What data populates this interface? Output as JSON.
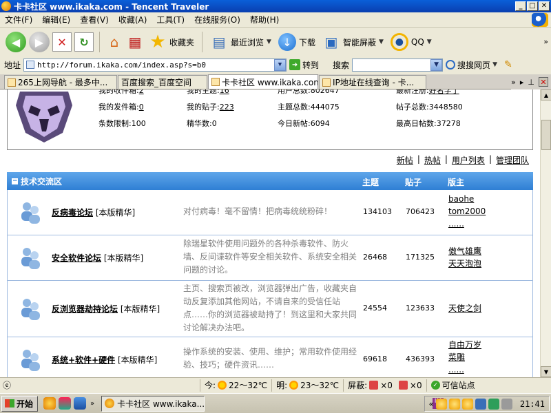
{
  "window": {
    "title": "卡卡社区 www.ikaka.com - Tencent Traveler",
    "btn_min": "_",
    "btn_max": "□",
    "btn_close": "✕"
  },
  "menu": [
    "文件(F)",
    "编辑(E)",
    "查看(V)",
    "收藏(A)",
    "工具(T)",
    "在线服务(O)",
    "帮助(H)"
  ],
  "toolbar": {
    "favorites": "收藏夹",
    "recent": "最近浏览",
    "download": "下载",
    "smart_block": "智能屏蔽",
    "qq": "QQ",
    "more": "»"
  },
  "address": {
    "label": "地址",
    "url": "http://forum.ikaka.com/index.asp?s=b0",
    "go": "转到",
    "search_label": "搜索",
    "search_web": "搜搜网页"
  },
  "tabs": [
    {
      "label": "265上网导航 - 最多中...",
      "active": false
    },
    {
      "label": "百度搜索_百度空间",
      "active": false
    },
    {
      "label": "卡卡社区 www.ikaka.com",
      "active": true
    },
    {
      "label": "IP地址在线查询 - 卡...",
      "active": false
    }
  ],
  "tab_tools": {
    "more": "»",
    "close": "✕"
  },
  "profile": {
    "cut_row": [
      {
        "label": "我的收件箱:",
        "value": "2"
      },
      {
        "label": "我的主题:",
        "value": "16"
      },
      {
        "label": "用户总数:",
        "value": "802647"
      },
      {
        "label": "最新注册:",
        "value": "好名字了"
      }
    ],
    "row1": [
      {
        "label": "我的发件箱:",
        "value": "0"
      },
      {
        "label": "我的贴子:",
        "value": "223"
      },
      {
        "label": "主题总数:",
        "value": "444075"
      },
      {
        "label": "帖子总数:",
        "value": "3448580"
      }
    ],
    "row2": [
      {
        "label": "条数限制:",
        "value": "100"
      },
      {
        "label": "精华数:",
        "value": "0"
      },
      {
        "label": "今日新帖:",
        "value": "6094"
      },
      {
        "label": "最高日帖数:",
        "value": "37278"
      }
    ]
  },
  "quick_links": [
    "新帖",
    "热帖",
    "用户列表",
    "管理团队"
  ],
  "quick_sep": "|",
  "section": {
    "title": "技术交流区",
    "col_topics": "主题",
    "col_posts": "贴子",
    "col_mods": "版主"
  },
  "forums": [
    {
      "name": "反病毒论坛",
      "tag": "[本版精华]",
      "desc": "对付病毒！毫不留情！把病毒统统粉碎！",
      "topics": "134103",
      "posts": "706423",
      "mods": [
        "baohe",
        "tom2000",
        "......"
      ]
    },
    {
      "name": "安全软件论坛",
      "tag": "[本版精华]",
      "desc": "除瑞星软件使用问题外的各种杀毒软件、防火墙、反间谍软件等安全相关软件、系统安全相关问题的讨论。",
      "topics": "26468",
      "posts": "171325",
      "mods": [
        "傲气雄鹰",
        "天天泡泡"
      ]
    },
    {
      "name": "反浏览器劫持论坛",
      "tag": "[本版精华]",
      "desc": "主页、搜索页被改，浏览器弹出广告，收藏夹自动反复添加其他网站，不请自来的受信任站点……你的浏览器被劫持了！到这里和大家共同讨论解决办法吧。",
      "topics": "24554",
      "posts": "123633",
      "mods": [
        "天使之剑"
      ]
    },
    {
      "name": "系统+软件+硬件",
      "tag": "[本版精华]",
      "desc": "操作系统的安装、使用、维护；常用软件使用经验、技巧；硬件资讯……",
      "topics": "69618",
      "posts": "436393",
      "mods": [
        "自由万岁",
        "菜雕",
        "......"
      ]
    }
  ],
  "status": {
    "today_label": "今:",
    "today_temp": "22～32℃",
    "tomorrow_label": "明:",
    "tomorrow_temp": "23～32℃",
    "block_label": "屏蔽:",
    "block_count1": "×0",
    "block_count2": "×0",
    "trusted": "可信站点"
  },
  "taskbar": {
    "start": "开始",
    "task_title": "卡卡社区 www.ikaka....",
    "tray_expand": "«",
    "clock": "21:41"
  },
  "colors": {
    "section_header": "#2f7fd4",
    "title_bar": "#0a5fd8"
  }
}
